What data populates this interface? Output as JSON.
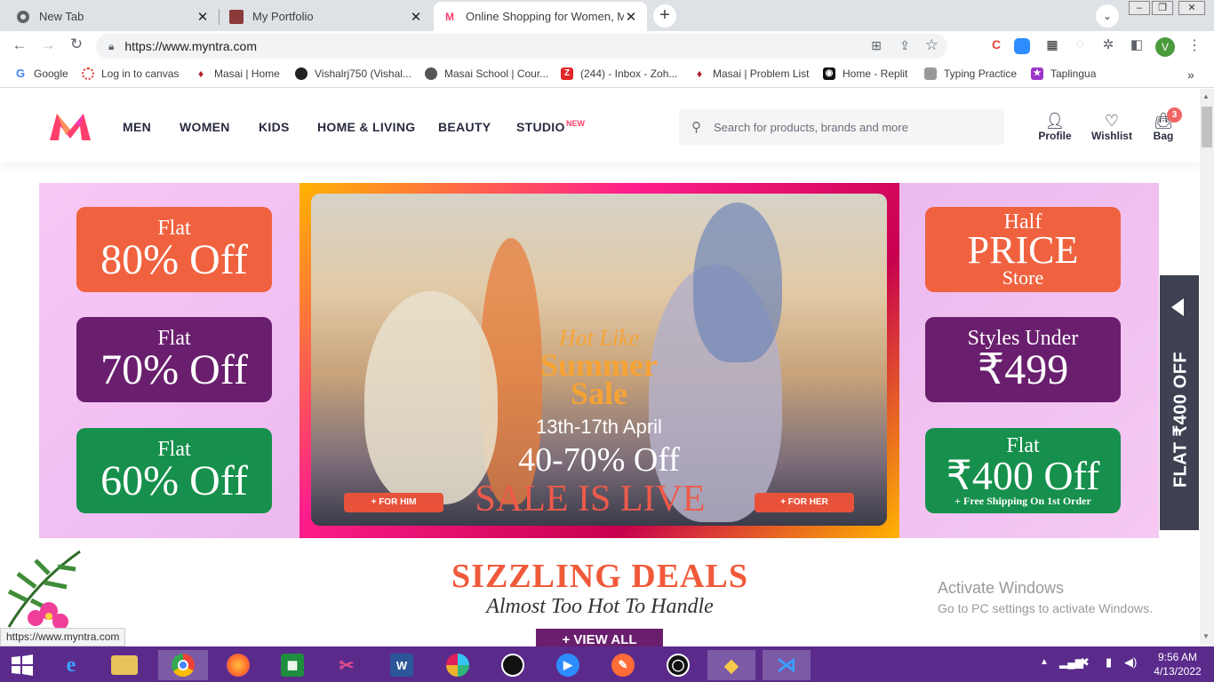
{
  "tabs": [
    {
      "title": "New Tab",
      "icon": "chrome-icon"
    },
    {
      "title": "My Portfolio",
      "icon": "portfolio-icon"
    },
    {
      "title": "Online Shopping for Women, Me",
      "icon": "myntra-icon"
    }
  ],
  "address": {
    "url": "https://www.myntra.com"
  },
  "profile_initial": "V",
  "bookmarks": [
    {
      "label": "Google"
    },
    {
      "label": "Log in to canvas"
    },
    {
      "label": "Masai | Home"
    },
    {
      "label": "Vishalrj750 (Vishal..."
    },
    {
      "label": "Masai School | Cour..."
    },
    {
      "label": "(244) - Inbox - Zoh..."
    },
    {
      "label": "Masai | Problem List"
    },
    {
      "label": "Home - Replit"
    },
    {
      "label": "Typing Practice"
    },
    {
      "label": "Taplingua"
    }
  ],
  "nav": {
    "items": [
      "MEN",
      "WOMEN",
      "KIDS",
      "HOME & LIVING",
      "BEAUTY",
      "STUDIO"
    ],
    "studio_badge": "NEW"
  },
  "search": {
    "placeholder": "Search for products, brands and more"
  },
  "actions": {
    "profile": "Profile",
    "wishlist": "Wishlist",
    "bag": "Bag",
    "bag_count": "3"
  },
  "banner": {
    "left_tiles": [
      {
        "a": "Flat",
        "b": "80% Off"
      },
      {
        "a": "Flat",
        "b": "70% Off"
      },
      {
        "a": "Flat",
        "b": "60% Off"
      }
    ],
    "right_tiles": [
      {
        "a": "Half",
        "b": "PRICE",
        "c": "Store"
      },
      {
        "a": "Styles Under",
        "b": "₹499"
      },
      {
        "a": "Flat",
        "b": "₹400 Off",
        "s": "+ Free Shipping On 1st Order"
      }
    ],
    "center": {
      "line1": "Hot Like",
      "line2": "Summer",
      "line3": "Sale",
      "dates": "13th-17th April",
      "discount": "40-70% Off",
      "live": "SALE IS LIVE",
      "him": "+ FOR HIM",
      "her": "+ FOR HER"
    }
  },
  "side_tab": {
    "label": "FLAT ₹400 OFF"
  },
  "deals": {
    "title": "SIZZLING DEALS",
    "subtitle": "Almost Too Hot To Handle",
    "button": "+ VIEW ALL"
  },
  "watermark": {
    "line1": "Activate Windows",
    "line2": "Go to PC settings to activate Windows."
  },
  "status_url": "https://www.myntra.com",
  "clock": {
    "time": "9:56 AM",
    "date": "4/13/2022"
  },
  "colors": {
    "myntra_pink": "#ff3f6c",
    "orange_tile": "#f0623f",
    "purple_tile": "#6a1f6e",
    "green_tile": "#16904c",
    "taskbar": "#5b2b8c"
  }
}
